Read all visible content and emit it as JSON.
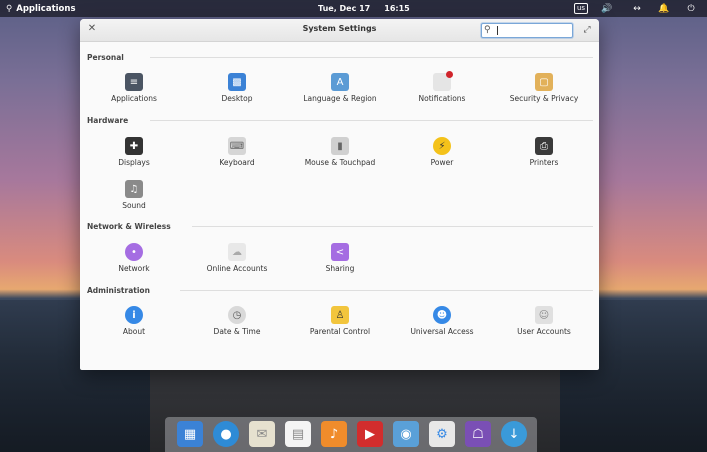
{
  "panel": {
    "applications": "Applications",
    "date": "Tue, Dec 17",
    "time": "16:15",
    "keyboard_layout": "us",
    "icons": [
      "search-icon",
      "keyboard-layout-icon",
      "volume-icon",
      "network-icon",
      "notification-bell-icon",
      "power-icon"
    ]
  },
  "window": {
    "title": "System Settings",
    "search_value": "",
    "search_placeholder": ""
  },
  "sections": [
    {
      "title": "Personal",
      "items": [
        "Applications",
        "Desktop",
        "Language & Region",
        "Notifications",
        "Security & Privacy"
      ]
    },
    {
      "title": "Hardware",
      "items": [
        "Displays",
        "Keyboard",
        "Mouse & Touchpad",
        "Power",
        "Printers",
        "Sound"
      ]
    },
    {
      "title": "Network & Wireless",
      "items": [
        "Network",
        "Online Accounts",
        "Sharing"
      ]
    },
    {
      "title": "Administration",
      "items": [
        "About",
        "Date & Time",
        "Parental Control",
        "Universal Access",
        "User Accounts"
      ]
    }
  ],
  "dock": {
    "apps": [
      "multitasking-view-icon",
      "web-browser-icon",
      "mail-icon",
      "calendar-icon",
      "music-icon",
      "videos-icon",
      "photos-icon",
      "system-settings-icon",
      "app-center-icon",
      "update-icon"
    ]
  },
  "colors": {
    "panel_bg": "#000000",
    "window_bg": "#fafafa",
    "accent_blue": "#3689e6"
  }
}
